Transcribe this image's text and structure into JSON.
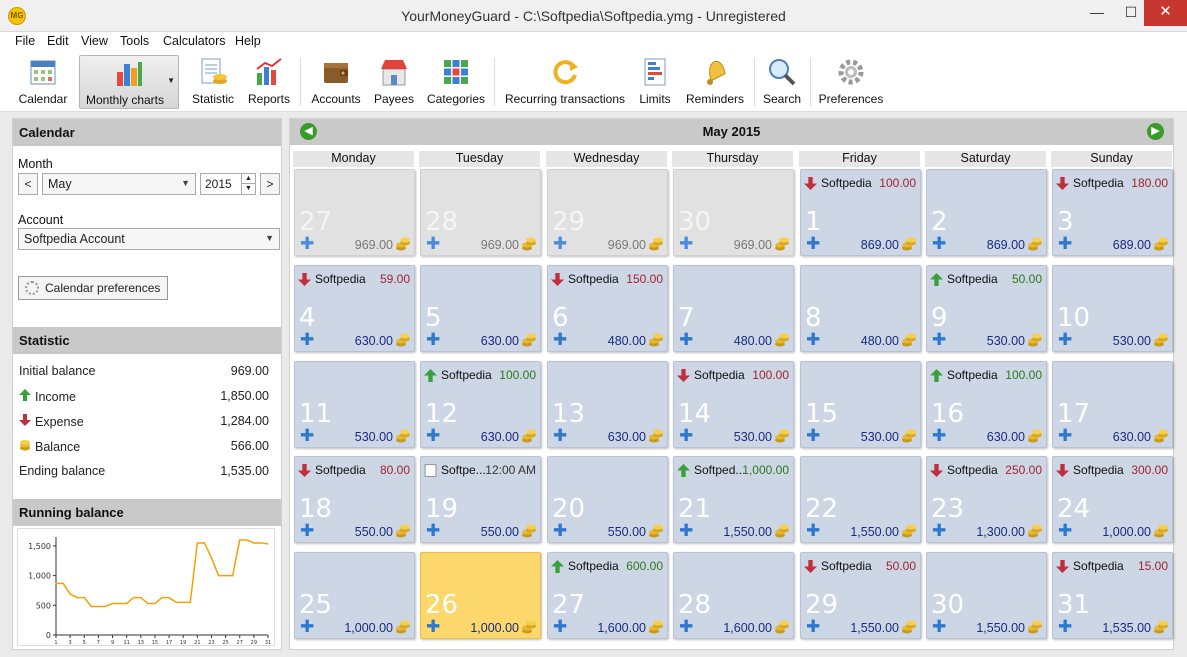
{
  "window": {
    "title": "YourMoneyGuard - C:\\Softpedia\\Softpedia.ymg - Unregistered",
    "app_icon": "MG",
    "controls": {
      "minimize": "—",
      "maximize": "☐",
      "close": "✕"
    }
  },
  "menu": [
    "File",
    "Edit",
    "View",
    "Tools",
    "Calculators",
    "Help"
  ],
  "toolbar": [
    {
      "label": "Calendar",
      "icon": "calendar-icon"
    },
    {
      "label": "Monthly charts",
      "icon": "bar-chart-icon",
      "active": true
    },
    {
      "label": "Statistic",
      "icon": "statistic-icon"
    },
    {
      "label": "Reports",
      "icon": "reports-icon"
    },
    {
      "label": "Accounts",
      "icon": "wallet-icon"
    },
    {
      "label": "Payees",
      "icon": "store-icon"
    },
    {
      "label": "Categories",
      "icon": "categories-grid-icon"
    },
    {
      "label": "Recurring transactions",
      "icon": "recurring-icon"
    },
    {
      "label": "Limits",
      "icon": "limits-icon"
    },
    {
      "label": "Reminders",
      "icon": "bell-icon"
    },
    {
      "label": "Search",
      "icon": "magnifier-icon"
    },
    {
      "label": "Preferences",
      "icon": "gear-icon"
    }
  ],
  "sidebar": {
    "calendar_title": "Calendar",
    "month_label": "Month",
    "prev_symbol": "<",
    "next_symbol": ">",
    "month_value": "May",
    "year_value": "2015",
    "account_label": "Account",
    "account_value": "Softpedia Account",
    "calendar_prefs_label": "Calendar preferences",
    "statistic_title": "Statistic",
    "stats": [
      {
        "label": "Initial balance",
        "value": "969.00",
        "icon": ""
      },
      {
        "label": "Income",
        "value": "1,850.00",
        "icon": "up-arrow-icon"
      },
      {
        "label": "Expense",
        "value": "1,284.00",
        "icon": "down-arrow-icon"
      },
      {
        "label": "Balance",
        "value": "566.00",
        "icon": "coins-icon"
      },
      {
        "label": "Ending balance",
        "value": "1,535.00",
        "icon": ""
      }
    ],
    "running_title": "Running balance"
  },
  "chart_data": {
    "type": "line",
    "title": "Running balance",
    "x": [
      1,
      2,
      3,
      4,
      5,
      6,
      7,
      8,
      9,
      10,
      11,
      12,
      13,
      14,
      15,
      16,
      17,
      18,
      19,
      20,
      21,
      22,
      23,
      24,
      25,
      26,
      27,
      28,
      29,
      30,
      31
    ],
    "values": [
      869,
      869,
      689,
      630,
      630,
      480,
      480,
      480,
      530,
      530,
      530,
      630,
      630,
      530,
      530,
      630,
      630,
      550,
      550,
      550,
      1550,
      1550,
      1300,
      1000,
      1000,
      1000,
      1600,
      1600,
      1550,
      1550,
      1535
    ],
    "y_ticks": [
      "0",
      "500",
      "1,000",
      "1,500"
    ],
    "ylim": [
      0,
      1650
    ],
    "x_ticks": [
      "1",
      "3",
      "5",
      "7",
      "9",
      "11",
      "13",
      "15",
      "17",
      "19",
      "21",
      "23",
      "25",
      "27",
      "29",
      "31"
    ],
    "line_color": "#f5a000"
  },
  "calendar": {
    "month_title": "May 2015",
    "prev_month_icon": "◀",
    "next_month_icon": "▶",
    "weekdays": [
      "Monday",
      "Tuesday",
      "Wednesday",
      "Thursday",
      "Friday",
      "Saturday",
      "Sunday"
    ],
    "days": [
      {
        "d": "27",
        "bal": "969.00",
        "other": true
      },
      {
        "d": "28",
        "bal": "969.00",
        "other": true
      },
      {
        "d": "29",
        "bal": "969.00",
        "other": true
      },
      {
        "d": "30",
        "bal": "969.00",
        "other": true
      },
      {
        "d": "1",
        "bal": "869.00",
        "ev": {
          "type": "exp",
          "name": "Softpedia",
          "amt": "100.00"
        }
      },
      {
        "d": "2",
        "bal": "869.00"
      },
      {
        "d": "3",
        "bal": "689.00",
        "ev": {
          "type": "exp",
          "name": "Softpedia",
          "amt": "180.00"
        }
      },
      {
        "d": "4",
        "bal": "630.00",
        "ev": {
          "type": "exp",
          "name": "Softpedia",
          "amt": "59.00"
        }
      },
      {
        "d": "5",
        "bal": "630.00"
      },
      {
        "d": "6",
        "bal": "480.00",
        "ev": {
          "type": "exp",
          "name": "Softpedia",
          "amt": "150.00"
        }
      },
      {
        "d": "7",
        "bal": "480.00"
      },
      {
        "d": "8",
        "bal": "480.00"
      },
      {
        "d": "9",
        "bal": "530.00",
        "ev": {
          "type": "inc",
          "name": "Softpedia",
          "amt": "50.00"
        }
      },
      {
        "d": "10",
        "bal": "530.00"
      },
      {
        "d": "11",
        "bal": "530.00"
      },
      {
        "d": "12",
        "bal": "630.00",
        "ev": {
          "type": "inc",
          "name": "Softpedia",
          "amt": "100.00"
        }
      },
      {
        "d": "13",
        "bal": "630.00"
      },
      {
        "d": "14",
        "bal": "530.00",
        "ev": {
          "type": "exp",
          "name": "Softpedia",
          "amt": "100.00"
        }
      },
      {
        "d": "15",
        "bal": "530.00"
      },
      {
        "d": "16",
        "bal": "630.00",
        "ev": {
          "type": "inc",
          "name": "Softpedia",
          "amt": "100.00"
        }
      },
      {
        "d": "17",
        "bal": "630.00"
      },
      {
        "d": "18",
        "bal": "550.00",
        "ev": {
          "type": "exp",
          "name": "Softpedia",
          "amt": "80.00"
        }
      },
      {
        "d": "19",
        "bal": "550.00",
        "ev": {
          "type": "neu",
          "name": "Softpe...",
          "amt": "12:00 AM"
        }
      },
      {
        "d": "20",
        "bal": "550.00"
      },
      {
        "d": "21",
        "bal": "1,550.00",
        "ev": {
          "type": "inc",
          "name": "Softped...",
          "amt": "1,000.00"
        }
      },
      {
        "d": "22",
        "bal": "1,550.00"
      },
      {
        "d": "23",
        "bal": "1,300.00",
        "ev": {
          "type": "exp",
          "name": "Softpedia",
          "amt": "250.00"
        }
      },
      {
        "d": "24",
        "bal": "1,000.00",
        "ev": {
          "type": "exp",
          "name": "Softpedia",
          "amt": "300.00"
        }
      },
      {
        "d": "25",
        "bal": "1,000.00"
      },
      {
        "d": "26",
        "bal": "1,000.00",
        "today": true
      },
      {
        "d": "27",
        "bal": "1,600.00",
        "ev": {
          "type": "inc",
          "name": "Softpedia",
          "amt": "600.00"
        }
      },
      {
        "d": "28",
        "bal": "1,600.00"
      },
      {
        "d": "29",
        "bal": "1,550.00",
        "ev": {
          "type": "exp",
          "name": "Softpedia",
          "amt": "50.00"
        }
      },
      {
        "d": "30",
        "bal": "1,550.00"
      },
      {
        "d": "31",
        "bal": "1,535.00",
        "ev": {
          "type": "exp",
          "name": "Softpedia",
          "amt": "15.00"
        }
      }
    ]
  }
}
